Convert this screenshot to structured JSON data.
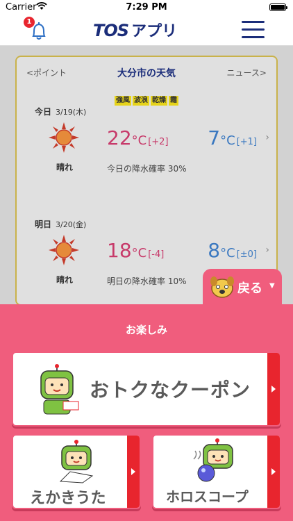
{
  "status_bar": {
    "carrier": "Carrier",
    "time": "7:29 PM"
  },
  "header": {
    "logo": "TOS",
    "logo_suffix": "アプリ",
    "notification_count": "1"
  },
  "weather": {
    "nav_left": "<ポイント",
    "title": "大分市の天気",
    "nav_right": "ニュース>",
    "tags": [
      "強風",
      "波浪",
      "乾燥",
      "霜"
    ],
    "days": [
      {
        "label": "今日",
        "date": "3/19(木)",
        "condition": "晴れ",
        "high": "22",
        "high_diff": "[+2]",
        "low": "7",
        "low_diff": "[+1]",
        "rain": "今日の降水確率 30%",
        "unit": "°C"
      },
      {
        "label": "明日",
        "date": "3/20(金)",
        "condition": "晴れ",
        "high": "18",
        "high_diff": "[-4]",
        "low": "8",
        "low_diff": "[±0]",
        "rain": "明日の降水確率 10%",
        "unit": "°C"
      }
    ]
  },
  "back_tab": {
    "label": "戻る"
  },
  "fun_panel": {
    "title": "お楽しみ",
    "coupon_label": "おトクなクーポン",
    "draw_label": "えかきうた",
    "horoscope_label": "ホロスコープ"
  },
  "colors": {
    "brand_navy": "#1b2d7a",
    "panel_pink": "#f05d7d",
    "accent_red": "#e8252e",
    "high_temp": "#c73a6a",
    "low_temp": "#3a78c0"
  }
}
